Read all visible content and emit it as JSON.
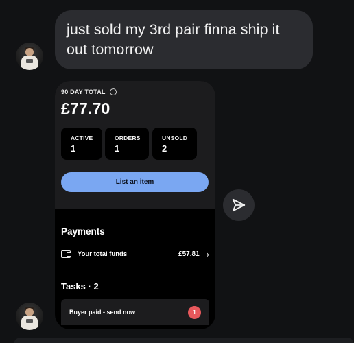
{
  "message": {
    "text": "just sold my 3rd pair finna ship it out tomorrow"
  },
  "card": {
    "total_label": "90 DAY TOTAL",
    "info_icon": "info-icon",
    "total_value": "£77.70",
    "stats": [
      {
        "label": "ACTIVE",
        "value": "1"
      },
      {
        "label": "ORDERS",
        "value": "1"
      },
      {
        "label": "UNSOLD",
        "value": "2"
      }
    ],
    "list_button": "List an item",
    "payments": {
      "heading": "Payments",
      "funds_label": "Your total funds",
      "funds_amount": "£57.81"
    },
    "tasks": {
      "heading": "Tasks · 2",
      "item_label": "Buyer paid - send now",
      "item_badge": "1"
    }
  },
  "colors": {
    "background": "#111214",
    "bubble": "#2b2c30",
    "accent_button": "#7aa7f2",
    "badge": "#e8585c"
  },
  "icons": {
    "share": "send-icon",
    "wallet": "wallet-icon",
    "chevron": "chevron-right-icon"
  }
}
